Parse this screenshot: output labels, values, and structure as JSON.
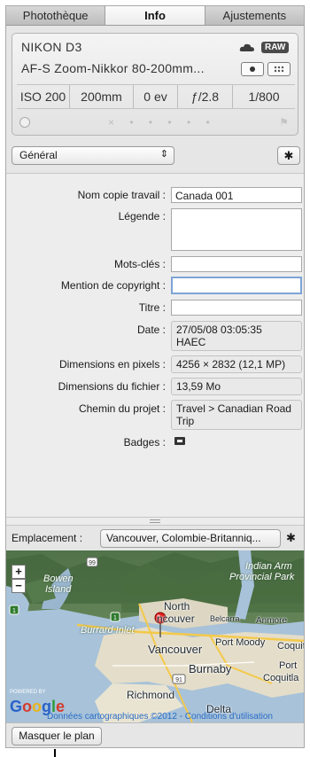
{
  "tabs": [
    {
      "label": "Photothèque",
      "active": false
    },
    {
      "label": "Info",
      "active": true
    },
    {
      "label": "Ajustements",
      "active": false
    }
  ],
  "camera": {
    "model": "NIKON D3",
    "lens": "AF-S Zoom-Nikkor 80-200mm...",
    "badge": "RAW",
    "exif": [
      "ISO 200",
      "200mm",
      "0 ev",
      "ƒ/2.8",
      "1/800"
    ],
    "rating_dots": "× • • • • •"
  },
  "preset": {
    "selected": "Général"
  },
  "metadata": {
    "version_name": {
      "label": "Nom copie travail :",
      "value": "Canada 001"
    },
    "caption": {
      "label": "Légende :",
      "value": ""
    },
    "keywords": {
      "label": "Mots-clés :",
      "value": ""
    },
    "copyright": {
      "label": "Mention de copyright :",
      "value": ""
    },
    "title": {
      "label": "Titre :",
      "value": ""
    },
    "date": {
      "label": "Date :",
      "value_line1": "27/05/08 03:05:35",
      "value_line2": "HAEC"
    },
    "pixel_dims": {
      "label": "Dimensions en pixels :",
      "value": "4256 × 2832 (12,1 MP)"
    },
    "file_size": {
      "label": "Dimensions du fichier :",
      "value": "13,59 Mo"
    },
    "project_path": {
      "label": "Chemin du projet :",
      "value_line1": "Travel > Canadian Road",
      "value_line2": "Trip"
    },
    "badges": {
      "label": "Badges :"
    }
  },
  "location": {
    "label": "Emplacement :",
    "value": "Vancouver, Colombie-Britanniq..."
  },
  "map": {
    "labels": [
      "Bowen",
      "Island",
      "Indian Arm",
      "Provincial Park",
      "North",
      "ncouver",
      "Belcarra",
      "Anmore",
      "Burrard Inlet",
      "Port Moody",
      "Coquit",
      "Vancouver",
      "Burnaby",
      "Port",
      "Coquitla",
      "Richmond",
      "Delta"
    ],
    "powered_by": "POWERED BY",
    "brand": "Google",
    "copyright": "Données cartographiques ©2012 - Conditions d'utilisation",
    "highway_markers": [
      "99",
      "1",
      "1",
      "91"
    ]
  },
  "footer": {
    "hide_map_button": "Masquer le plan"
  }
}
